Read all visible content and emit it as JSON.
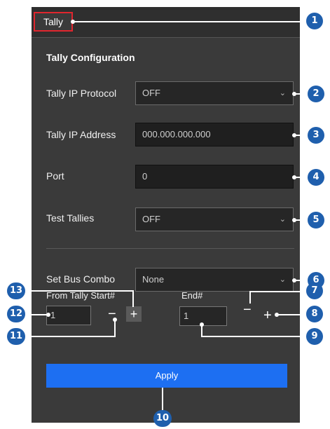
{
  "tab": {
    "label": "Tally"
  },
  "section": {
    "title": "Tally Configuration"
  },
  "fields": {
    "protocol": {
      "label": "Tally IP Protocol",
      "value": "OFF"
    },
    "address": {
      "label": "Tally IP Address",
      "value": "000.000.000.000"
    },
    "port": {
      "label": "Port",
      "value": "0"
    },
    "test": {
      "label": "Test Tallies",
      "value": "OFF"
    },
    "bus": {
      "label": "Set Bus Combo",
      "value": "None"
    }
  },
  "range": {
    "start_label": "From Tally Start#",
    "start_value": "1",
    "end_label": "End#",
    "end_value": "1",
    "minus": "−",
    "plus": "+"
  },
  "apply_label": "Apply",
  "callouts": [
    "1",
    "2",
    "3",
    "4",
    "5",
    "6",
    "7",
    "8",
    "9",
    "10",
    "11",
    "12",
    "13"
  ],
  "colors": {
    "accent": "#1d6ff2",
    "callout": "#1f5fad",
    "tab_highlight": "#e0262e",
    "panel": "#3a3a3a"
  },
  "icons": {
    "dropdown": "chevron-down-icon"
  }
}
